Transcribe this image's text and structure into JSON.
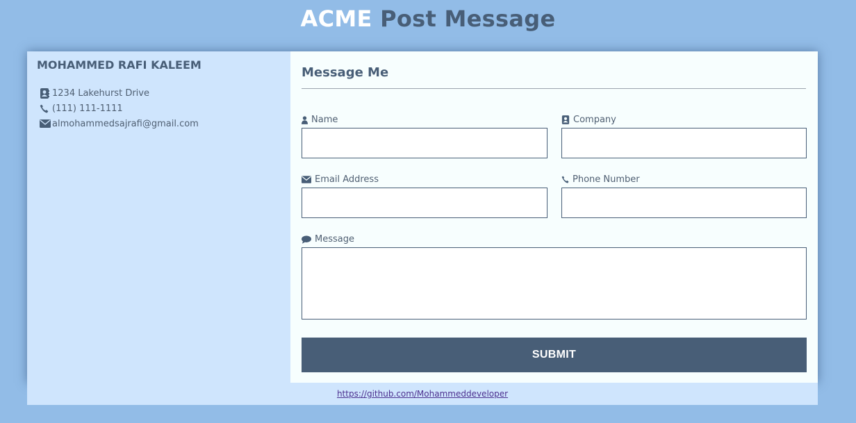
{
  "header": {
    "brand": "ACME",
    "title_rest": "Post Message"
  },
  "contact": {
    "name": "MOHAMMED RAFI KALEEM",
    "address": "1234 Lakehurst Drive",
    "phone": "(111) 111-1111",
    "email": "almohammedsajrafi@gmail.com"
  },
  "form": {
    "title": "Message Me",
    "name_label": "Name",
    "company_label": "Company",
    "email_label": "Email Address",
    "phone_label": "Phone Number",
    "message_label": "Message",
    "name_value": "",
    "company_value": "",
    "email_value": "",
    "phone_value": "",
    "message_value": "",
    "submit_label": "SUBMIT"
  },
  "footer": {
    "link_text": "https://github.com/Mohammeddeveloper"
  },
  "colors": {
    "background": "#92bce7",
    "accent": "#485e77",
    "panel": "#cfe5fd",
    "form_bg": "#f7fefe"
  },
  "icons": {
    "address": "address-book-icon",
    "phone": "phone-icon",
    "email": "envelope-icon",
    "name": "user-icon",
    "company": "address-book-icon",
    "message": "comment-icon"
  }
}
